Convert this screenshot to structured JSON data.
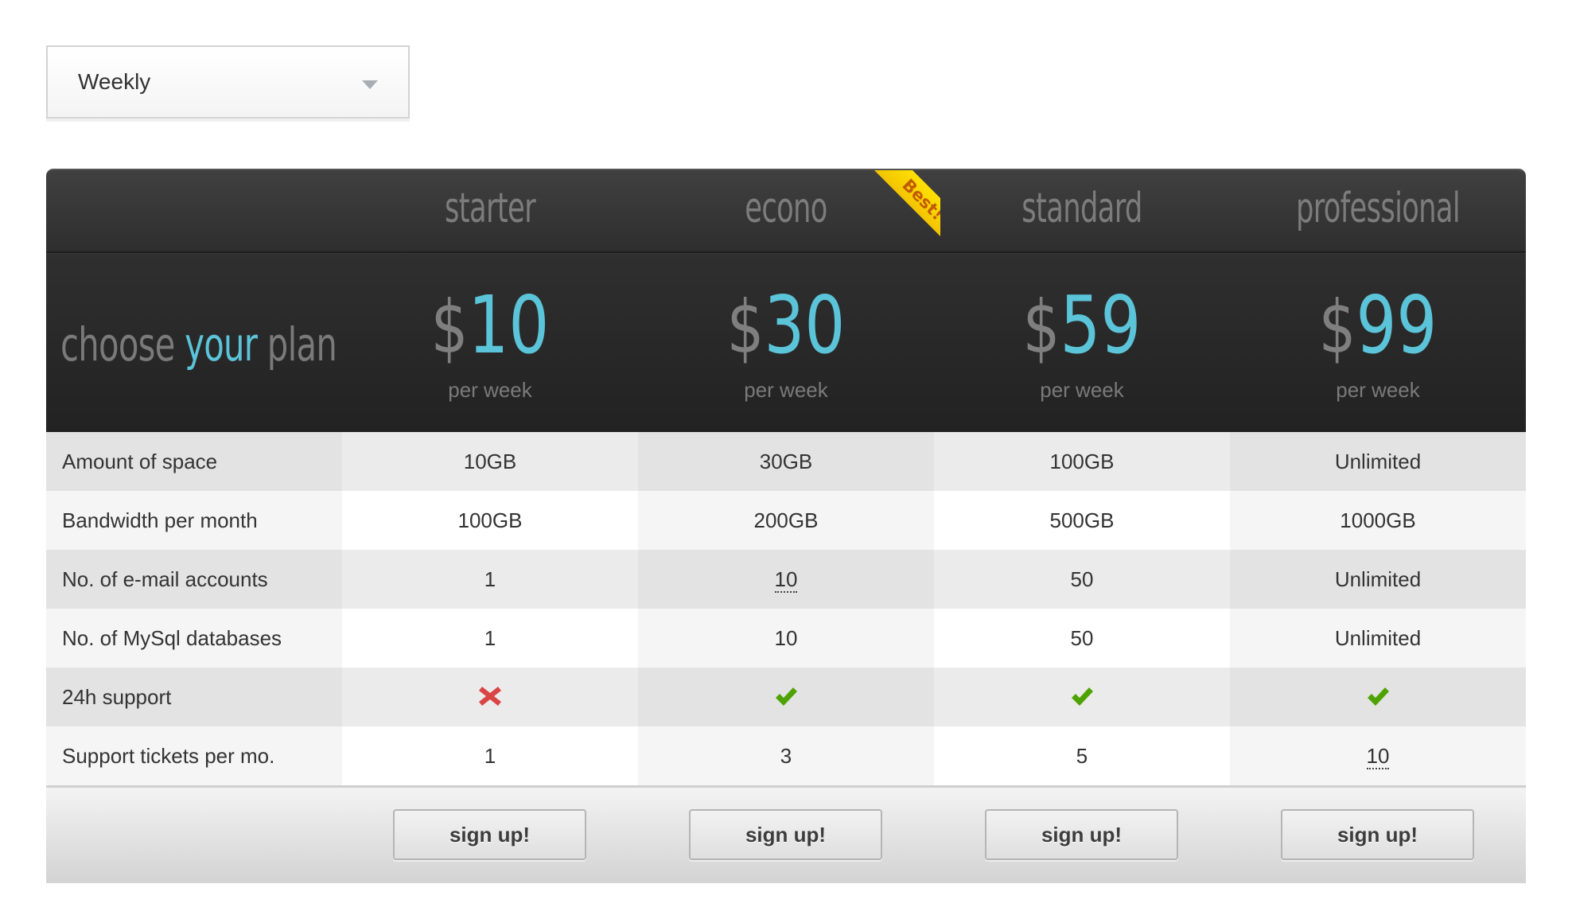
{
  "period_select": {
    "selected": "Weekly",
    "icon": "chevron-down-icon"
  },
  "header": {
    "tagline_parts": [
      "choose",
      "your",
      "plan"
    ],
    "ribbon_label": "Best!",
    "accent_color": "#5bc4d8",
    "ribbon_color": "#ffd500"
  },
  "plans": [
    {
      "name": "starter",
      "currency": "$",
      "price": "10",
      "period": "per week",
      "signup": "sign up!"
    },
    {
      "name": "econo",
      "currency": "$",
      "price": "30",
      "period": "per week",
      "signup": "sign up!",
      "badge": "Best!"
    },
    {
      "name": "standard",
      "currency": "$",
      "price": "59",
      "period": "per week",
      "signup": "sign up!"
    },
    {
      "name": "professional",
      "currency": "$",
      "price": "99",
      "period": "per week",
      "signup": "sign up!"
    }
  ],
  "features": [
    {
      "label": "Amount of space",
      "values": [
        "10GB",
        "30GB",
        "100GB",
        "Unlimited"
      ]
    },
    {
      "label": "Bandwidth per month",
      "values": [
        "100GB",
        "200GB",
        "500GB",
        "1000GB"
      ]
    },
    {
      "label": "No. of e-mail accounts",
      "values": [
        "1",
        "10",
        "50",
        "Unlimited"
      ]
    },
    {
      "label": "No. of MySql databases",
      "values": [
        "1",
        "10",
        "50",
        "Unlimited"
      ]
    },
    {
      "label": "24h support",
      "values": [
        "cross-icon",
        "check-icon",
        "check-icon",
        "check-icon"
      ]
    },
    {
      "label": "Support tickets per mo.",
      "values": [
        "1",
        "3",
        "5",
        "10"
      ]
    }
  ],
  "status_colors": {
    "yes": "#4fa300",
    "no": "#d94545"
  }
}
